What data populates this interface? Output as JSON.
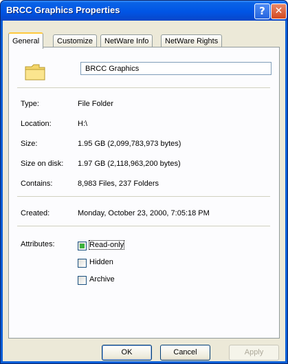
{
  "window": {
    "title": "BRCC Graphics Properties",
    "help_label": "?",
    "close_label": "✕"
  },
  "tabs": [
    {
      "label": "General",
      "active": true
    },
    {
      "label": "Customize",
      "active": false
    },
    {
      "label": "NetWare Info",
      "active": false
    },
    {
      "label": "NetWare Rights",
      "active": false
    }
  ],
  "general": {
    "name_value": "BRCC Graphics",
    "icon": "folder-icon",
    "type_label": "Type:",
    "type_value": "File Folder",
    "location_label": "Location:",
    "location_value": "H:\\",
    "size_label": "Size:",
    "size_value": "1.95 GB (2,099,783,973 bytes)",
    "size_on_disk_label": "Size on disk:",
    "size_on_disk_value": "1.97 GB (2,118,963,200 bytes)",
    "contains_label": "Contains:",
    "contains_value": "8,983 Files, 237 Folders",
    "created_label": "Created:",
    "created_value": "Monday, October 23, 2000, 7:05:18 PM",
    "attributes_label": "Attributes:",
    "attributes": [
      {
        "label": "Read-only",
        "checked": true
      },
      {
        "label": "Hidden",
        "checked": false
      },
      {
        "label": "Archive",
        "checked": false
      }
    ]
  },
  "buttons": {
    "ok": "OK",
    "cancel": "Cancel",
    "apply": "Apply"
  },
  "colors": {
    "titlebar": "#0055e5",
    "dialog_bg": "#ece9d8",
    "checkbox_fill": "#3cb13c"
  }
}
